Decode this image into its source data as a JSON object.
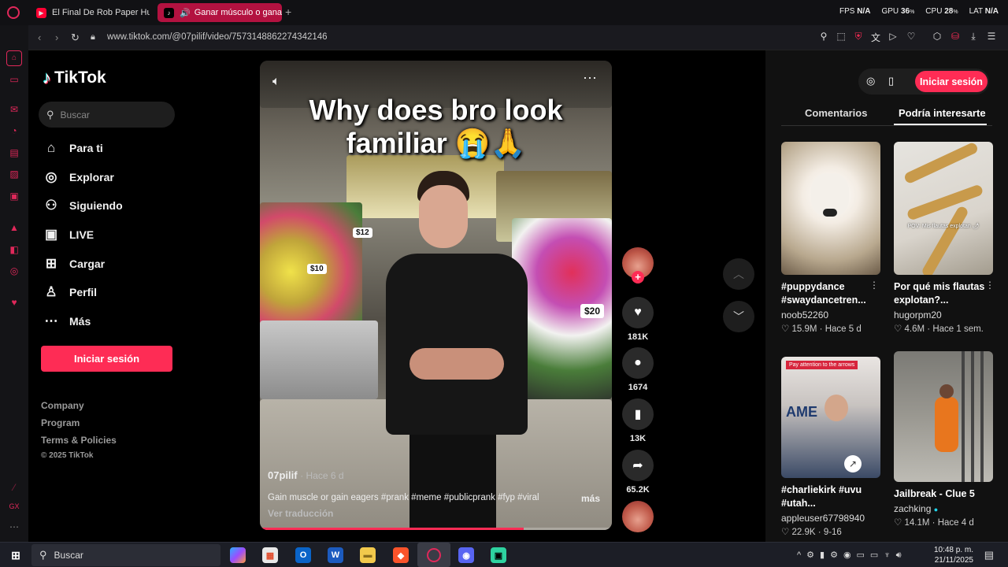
{
  "browser": {
    "tabs": [
      {
        "title": "El Final De Rob Paper Hun"
      },
      {
        "title": "Ganar músculo o gana"
      }
    ],
    "stats": {
      "fps_label": "FPS",
      "fps": "N/A",
      "gpu_label": "GPU",
      "gpu": "36",
      "cpu_label": "CPU",
      "cpu": "28",
      "lat_label": "LAT",
      "lat": "N/A"
    },
    "url": "www.tiktok.com/@07pilif/video/7573148862274342146"
  },
  "tiktok": {
    "brand": "TikTok",
    "search_placeholder": "Buscar",
    "nav": [
      {
        "label": "Para ti",
        "icon": "home-icon"
      },
      {
        "label": "Explorar",
        "icon": "compass-icon"
      },
      {
        "label": "Siguiendo",
        "icon": "following-icon"
      },
      {
        "label": "LIVE",
        "icon": "live-icon"
      },
      {
        "label": "Cargar",
        "icon": "upload-icon"
      },
      {
        "label": "Perfil",
        "icon": "profile-icon"
      },
      {
        "label": "Más",
        "icon": "more-icon"
      }
    ],
    "login_label": "Iniciar sesión",
    "footer": [
      "Company",
      "Program",
      "Terms & Policies"
    ],
    "copyright": "© 2025 TikTok"
  },
  "video": {
    "caption_line1": "Why does bro look",
    "caption_line2": "familiar 😭🙏",
    "author": "07pilif",
    "age": "· Hace 6 d",
    "description": "Gain muscle or gain eagers #prank #meme #publicprank #fyp #viral",
    "more_label": "más",
    "translate_label": "Ver traducción",
    "price_tags": [
      "$12",
      "$10",
      "$20"
    ],
    "progress": 0.75,
    "likes": "181K",
    "comments": "1674",
    "saves": "13K",
    "shares": "65.2K"
  },
  "right_panel": {
    "login_label": "Iniciar sesión",
    "tab_comments": "Comentarios",
    "tab_suggested": "Podría interesarte",
    "cards": [
      {
        "title": "#puppydance #swaydancetren...",
        "author": "noob52260",
        "views": "15.9M",
        "age": "Hace 5 d"
      },
      {
        "title": "Por qué mis flautas explotan?...",
        "author": "hugorpm20",
        "views": "4.6M",
        "age": "Hace 1 sem.",
        "overlay": "POV: Mis flautas explotan 🌶"
      },
      {
        "title": "#charliekirk #uvu #utah...",
        "author": "appleuser67798940",
        "views": "22.9K",
        "age": "9-16",
        "overlay": "Pay attention to the arrows"
      },
      {
        "title": "Jailbreak - Clue 5",
        "author": "zachking",
        "views": "14.1M",
        "age": "Hace 4 d"
      }
    ]
  },
  "taskbar": {
    "search_placeholder": "Buscar",
    "time": "10:48 p. m.",
    "date": "21/11/2025"
  }
}
